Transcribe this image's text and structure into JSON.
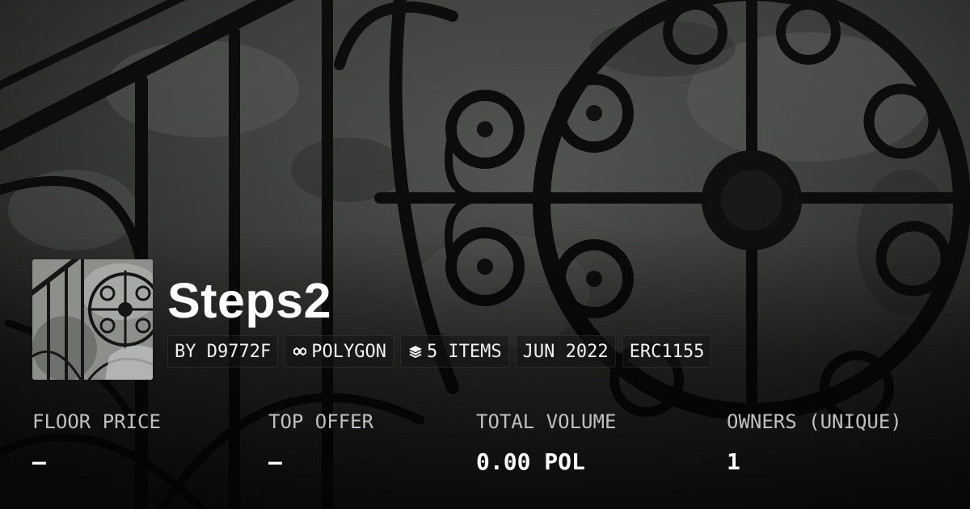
{
  "collection": {
    "name": "Steps2",
    "creator": "BY D9772F",
    "chain": "POLYGON",
    "items": "5 ITEMS",
    "date": "JUN 2022",
    "standard": "ERC1155"
  },
  "icons": {
    "chain": "polygon-link-icon",
    "items": "layers-icon"
  },
  "stats": [
    {
      "label": "FLOOR PRICE",
      "value": "–"
    },
    {
      "label": "TOP OFFER",
      "value": "–"
    },
    {
      "label": "TOTAL VOLUME",
      "value": "0.00 POL"
    },
    {
      "label": "OWNERS (UNIQUE)",
      "value": "1"
    }
  ],
  "colors": {
    "text": "#ffffff",
    "muted": "#bfc0c0",
    "chip_bg": "#141414"
  }
}
